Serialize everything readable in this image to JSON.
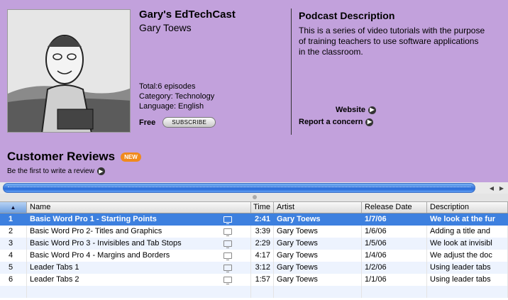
{
  "podcast": {
    "title": "Gary's EdTechCast",
    "author": "Gary Toews",
    "total": "Total:6 episodes",
    "category": "Category: Technology",
    "language": "Language: English",
    "price": "Free",
    "subscribe_label": "SUBSCRIBE"
  },
  "description": {
    "heading": "Podcast Description",
    "lines": [
      "This is a series of video tutorials with the purpose",
      "of training teachers to use software applications",
      "in the classroom."
    ],
    "website_label": "Website",
    "report_label": "Report a concern"
  },
  "reviews": {
    "title": "Customer Reviews",
    "badge": "NEW",
    "write_label": "Be the first to write a review"
  },
  "tracklist": {
    "columns": [
      "Name",
      "Time",
      "Artist",
      "Release Date",
      "Description"
    ],
    "rows": [
      {
        "num": "1",
        "name": "Basic Word Pro 1 - Starting Points",
        "time": "2:41",
        "artist": "Gary Toews",
        "date": "1/7/06",
        "desc": "We look at the fur"
      },
      {
        "num": "2",
        "name": "Basic Word Pro 2- Titles and Graphics",
        "time": "3:39",
        "artist": "Gary Toews",
        "date": "1/6/06",
        "desc": "Adding a title and"
      },
      {
        "num": "3",
        "name": "Basic Word Pro 3 - Invisibles and Tab Stops",
        "time": "2:29",
        "artist": "Gary Toews",
        "date": "1/5/06",
        "desc": "We look at invisibl"
      },
      {
        "num": "4",
        "name": "Basic Word Pro 4 - Margins and Borders",
        "time": "4:17",
        "artist": "Gary Toews",
        "date": "1/4/06",
        "desc": "We adjust the doc"
      },
      {
        "num": "5",
        "name": "Leader Tabs 1",
        "time": "3:12",
        "artist": "Gary Toews",
        "date": "1/2/06",
        "desc": "Using leader tabs"
      },
      {
        "num": "6",
        "name": "Leader Tabs 2",
        "time": "1:57",
        "artist": "Gary Toews",
        "date": "1/1/06",
        "desc": "Using leader tabs"
      }
    ]
  },
  "colors": {
    "background": "#c2a1dc",
    "selection": "#3d80df",
    "badge": "#f08a1c"
  }
}
